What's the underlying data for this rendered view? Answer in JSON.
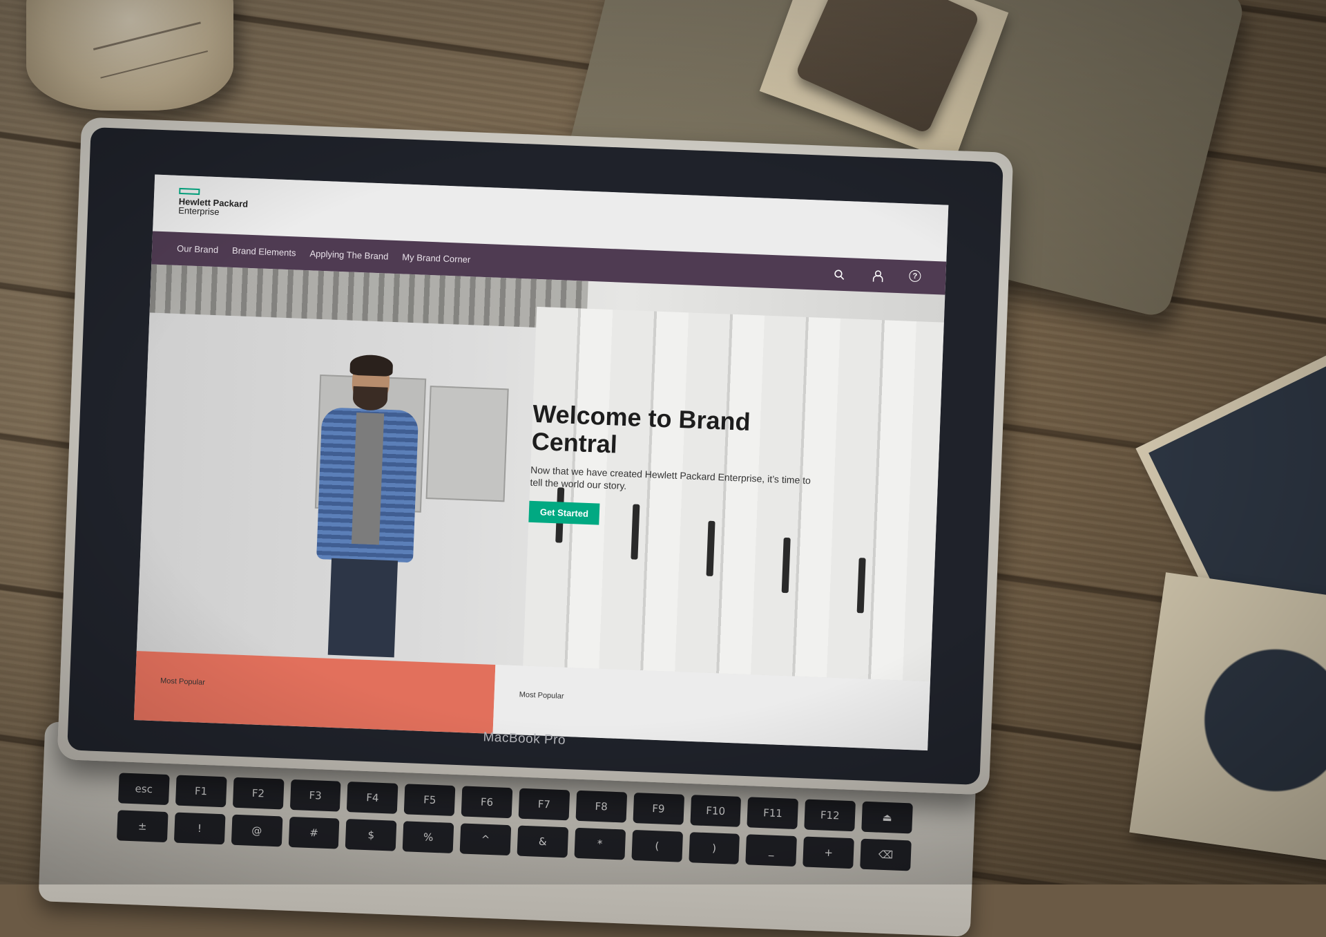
{
  "site": {
    "logo_line1": "Hewlett Packard",
    "logo_line2": "Enterprise",
    "accent_color": "#01a982",
    "nav_color": "#4f3b52"
  },
  "nav": {
    "items": [
      {
        "label": "Our Brand"
      },
      {
        "label": "Brand Elements"
      },
      {
        "label": "Applying The Brand"
      },
      {
        "label": "My Brand Corner"
      }
    ],
    "icons": [
      "search-icon",
      "user-icon",
      "help-icon"
    ],
    "help_glyph": "?"
  },
  "hero": {
    "title": "Welcome to Brand Central",
    "subtitle": "Now that we have created Hewlett Packard Enterprise, it’s time to tell the world our story.",
    "cta_label": "Get Started"
  },
  "popular": {
    "left_label": "Most Popular",
    "right_label": "Most Popular",
    "left_color": "#e2705c"
  },
  "laptop": {
    "model_label": "MacBook Pro",
    "keys": [
      "esc",
      "F1",
      "F2",
      "F3",
      "F4",
      "F5",
      "F6",
      "F7",
      "F8",
      "F9",
      "F10",
      "F11",
      "F12",
      "⏏",
      "±",
      "!",
      "@",
      "#",
      "$",
      "%",
      "^",
      "&",
      "*",
      "(",
      ")",
      "_",
      "+",
      "⌫"
    ]
  }
}
